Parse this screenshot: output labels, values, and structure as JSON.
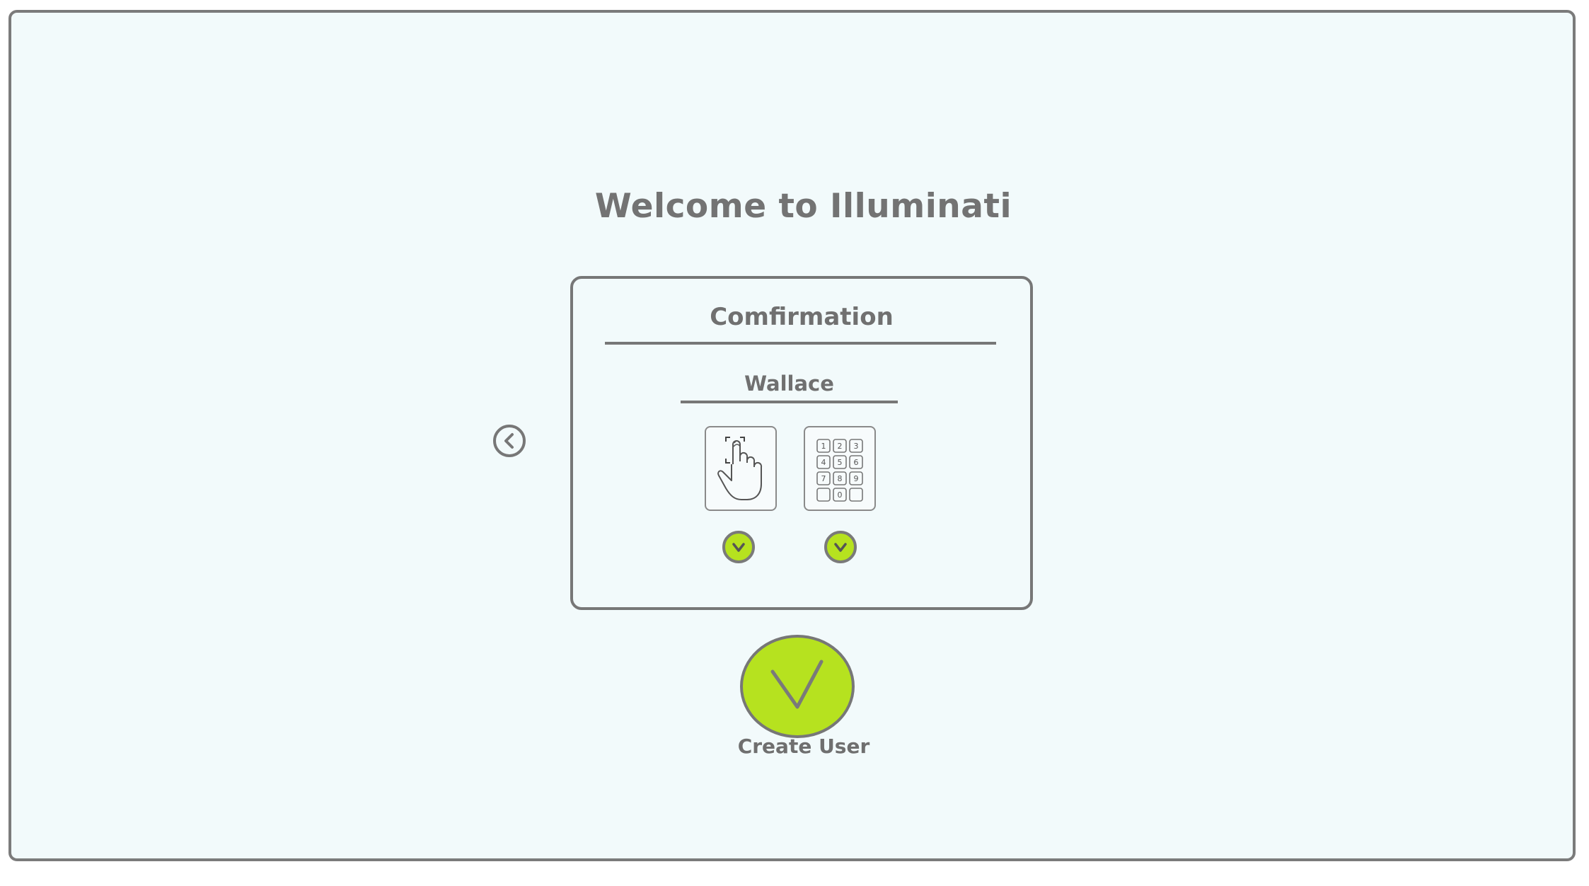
{
  "app": {
    "title": "Welcome to Illuminati"
  },
  "navigation": {
    "back_icon": "chevron-left-circle-icon"
  },
  "confirmation_card": {
    "title": "Comfirmation",
    "user_name": "Wallace",
    "methods": [
      {
        "name": "fingerprint",
        "icon": "fingerprint-touch-icon",
        "confirmed_icon": "check-circle-icon"
      },
      {
        "name": "pin",
        "icon": "keypad-icon",
        "confirmed_icon": "check-circle-icon",
        "keys": [
          "1",
          "2",
          "3",
          "4",
          "5",
          "6",
          "7",
          "8",
          "9",
          "",
          "0",
          ""
        ]
      }
    ]
  },
  "actions": {
    "create_user_label": "Create User",
    "create_user_icon": "check-mark-icon"
  },
  "colors": {
    "background": "#f2fafb",
    "border": "#777777",
    "accent": "#b6e21f",
    "text": "#737373"
  }
}
